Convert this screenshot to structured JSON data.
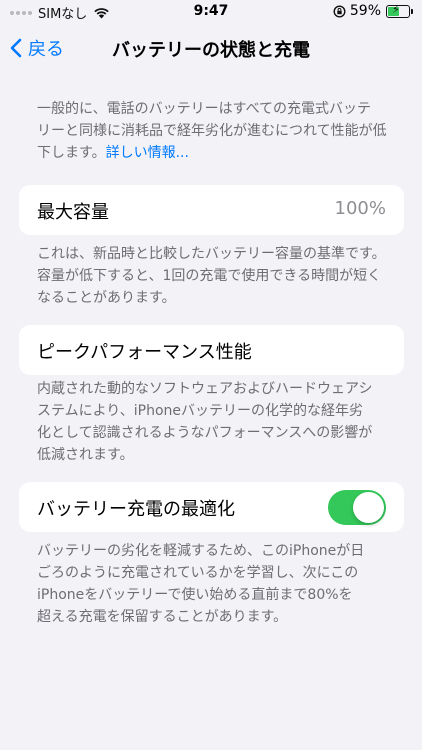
{
  "status_bar": {
    "carrier": "SIMなし",
    "time": "9:47",
    "battery_percent": "59%",
    "battery_level": 0.59,
    "battery_color": "#34c759"
  },
  "nav": {
    "back_label": "戻る",
    "title": "バッテリーの状態と充電"
  },
  "intro": {
    "line1": "一般的に、電話のバッテリーはすべての充電式バッテ",
    "line2": "リーと同様に消耗品で経年劣化が進むにつれて性能が低",
    "line3": "下します。",
    "link": "詳しい情報..."
  },
  "capacity": {
    "label": "最大容量",
    "value": "100%",
    "desc_line1": "これは、新品時と比較したバッテリー容量の基準です。",
    "desc_line2": "容量が低下すると、1回の充電で使用できる時間が短く",
    "desc_line3": "なることがあります。"
  },
  "performance": {
    "label": "ピークパフォーマンス性能",
    "desc_line1": "内蔵された動的なソフトウェアおよびハードウェアシ",
    "desc_line2": "ステムにより、iPhoneバッテリーの化学的な経年劣",
    "desc_line3": "化として認識されるようなパフォーマンスへの影響が",
    "desc_line4": "低減されます。"
  },
  "optimized": {
    "label": "バッテリー充電の最適化",
    "toggle_on": true,
    "toggle_color": "#34c759",
    "desc_line1": "バッテリーの劣化を軽減するため、このiPhoneが日",
    "desc_line2": "ごろのように充電されているかを学習し、次にこの",
    "desc_line3": "iPhoneをバッテリーで使い始める直前まで80%を",
    "desc_line4": "超える充電を保留することがあります。"
  },
  "accent_color": "#007aff"
}
